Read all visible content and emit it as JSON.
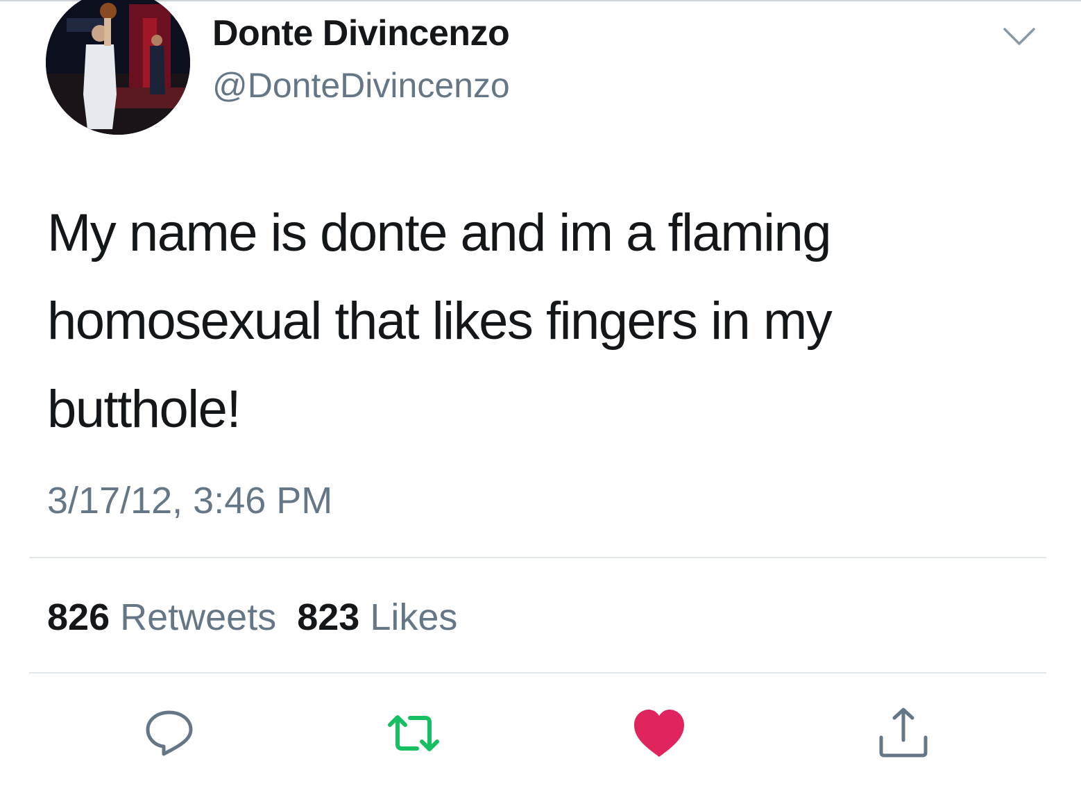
{
  "tweet": {
    "display_name": "Donte Divincenzo",
    "handle": "@DonteDivincenzo",
    "text": "My name is donte and im a flaming homosexual that likes fingers in my butthole!",
    "timestamp": "3/17/12, 3:46 PM"
  },
  "stats": {
    "retweets_count": "826",
    "retweets_label": "Retweets",
    "likes_count": "823",
    "likes_label": "Likes"
  },
  "actions": {
    "reply_icon": "reply-icon",
    "retweet_icon": "retweet-icon",
    "like_icon": "heart-icon",
    "share_icon": "share-icon"
  },
  "colors": {
    "secondary_text": "#657786",
    "retweet_active": "#17bf63",
    "like_active": "#e0245e",
    "divider": "#e1e8ed"
  }
}
